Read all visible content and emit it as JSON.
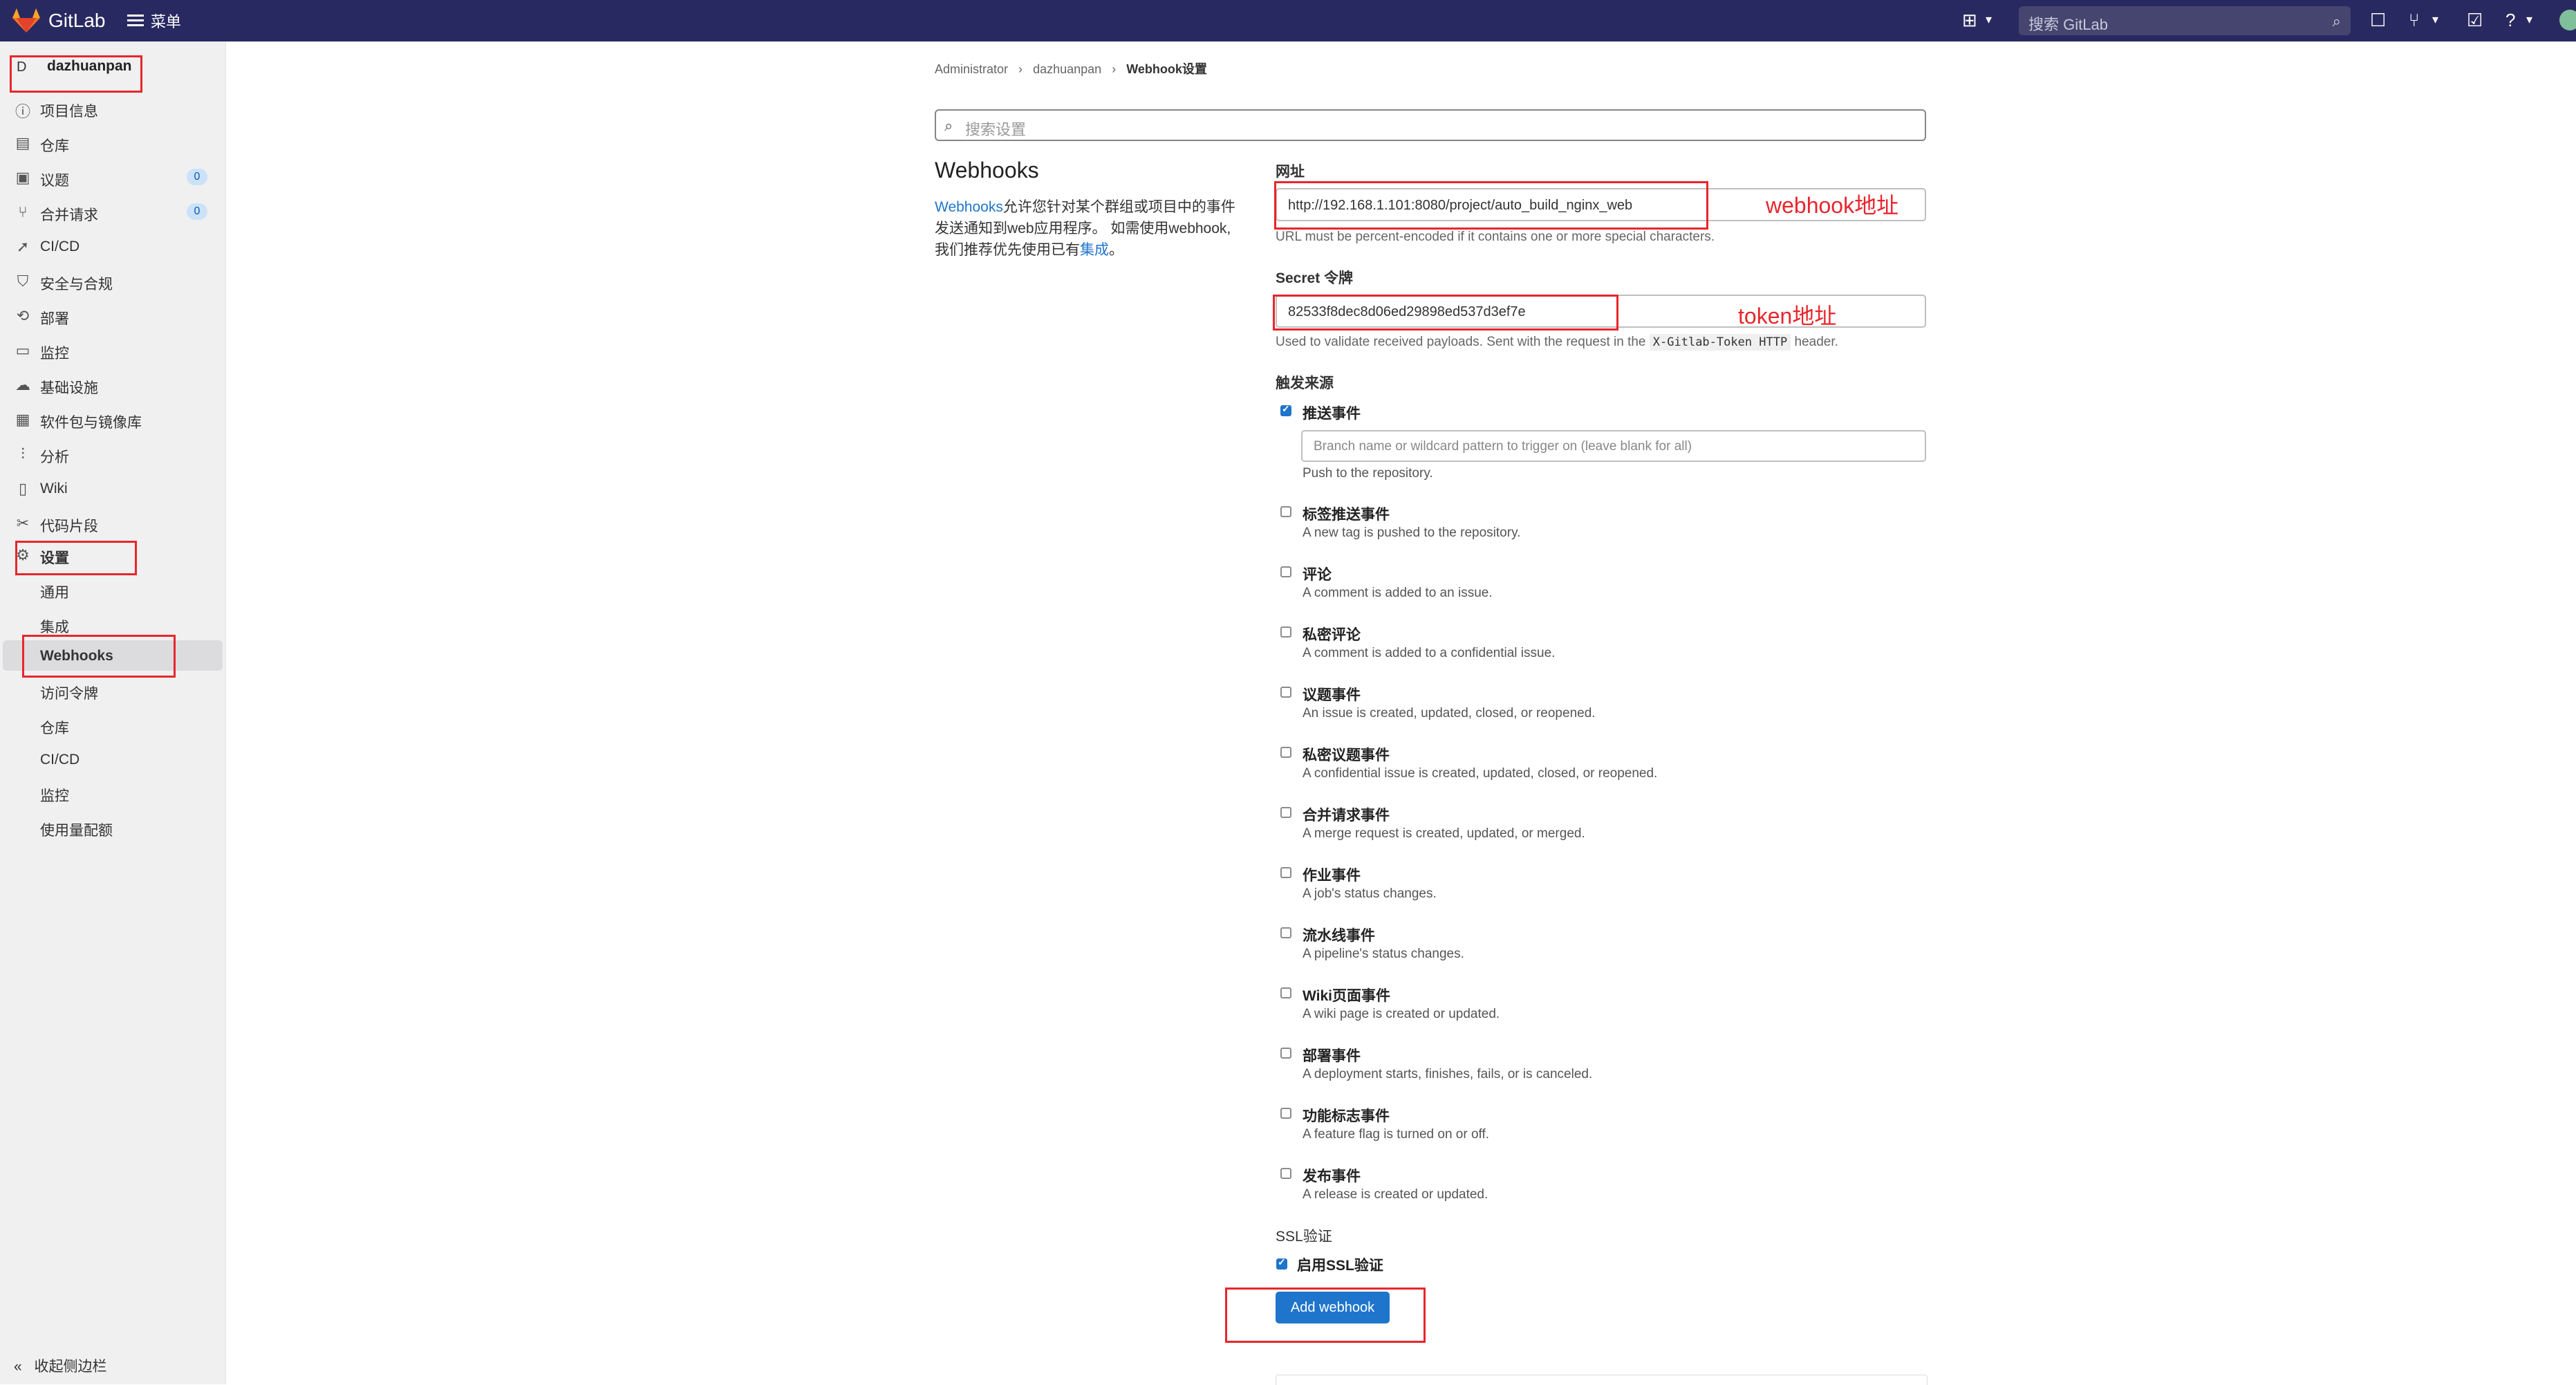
{
  "topnav": {
    "brand": "GitLab",
    "menu_label": "菜单",
    "search_placeholder": "搜索 GitLab",
    "icons": [
      "plus-square-icon",
      "chevron-down-icon",
      "issues-icon",
      "merge-request-icon",
      "todo-icon",
      "help-icon",
      "avatar"
    ]
  },
  "sidebar": {
    "project_avatar_letter": "D",
    "project_name": "dazhuanpan",
    "items": [
      {
        "label": "项目信息",
        "icon": "info-icon"
      },
      {
        "label": "仓库",
        "icon": "doc-icon"
      },
      {
        "label": "议题",
        "icon": "issues-icon",
        "count": "0"
      },
      {
        "label": "合并请求",
        "icon": "merge-request-icon",
        "count": "0"
      },
      {
        "label": "CI/CD",
        "icon": "rocket-icon"
      },
      {
        "label": "安全与合规",
        "icon": "shield-icon"
      },
      {
        "label": "部署",
        "icon": "deploy-icon"
      },
      {
        "label": "监控",
        "icon": "monitor-icon"
      },
      {
        "label": "基础设施",
        "icon": "cloud-icon"
      },
      {
        "label": "软件包与镜像库",
        "icon": "package-icon"
      },
      {
        "label": "分析",
        "icon": "chart-icon"
      },
      {
        "label": "Wiki",
        "icon": "book-icon"
      },
      {
        "label": "代码片段",
        "icon": "scissors-icon"
      },
      {
        "label": "设置",
        "icon": "gear-icon"
      }
    ],
    "settings_sub": [
      "通用",
      "集成",
      "Webhooks",
      "访问令牌",
      "仓库",
      "CI/CD",
      "监控",
      "使用量配额"
    ],
    "collapse_label": "收起侧边栏"
  },
  "breadcrumb": [
    "Administrator",
    "dazhuanpan",
    "Webhook设置"
  ],
  "settings_search_placeholder": "搜索设置",
  "section": {
    "title": "Webhooks",
    "desc_link": "Webhooks",
    "desc_text": "允许您针对某个群组或项目中的事件发送通知到web应用程序。 如需使用webhook,我们推荐优先使用已有",
    "desc_link2": "集成",
    "desc_end": "。"
  },
  "form": {
    "url_label": "网址",
    "url_value": "http://192.168.1.101:8080/project/auto_build_nginx_web",
    "url_help": "URL must be percent-encoded if it contains one or more special characters.",
    "secret_label": "Secret 令牌",
    "secret_value": "82533f8dec8d06ed29898ed537d3ef7e",
    "secret_help_pre": "Used to validate received payloads. Sent with the request in the",
    "secret_help_code": "X-Gitlab-Token HTTP",
    "secret_help_post": "header.",
    "trigger_label": "触发来源",
    "branch_placeholder": "Branch name or wildcard pattern to trigger on (leave blank for all)",
    "events": [
      {
        "title": "推送事件",
        "desc": "Push to the repository.",
        "checked": true
      },
      {
        "title": "标签推送事件",
        "desc": "A new tag is pushed to the repository.",
        "checked": false
      },
      {
        "title": "评论",
        "desc": "A comment is added to an issue.",
        "checked": false
      },
      {
        "title": "私密评论",
        "desc": "A comment is added to a confidential issue.",
        "checked": false
      },
      {
        "title": "议题事件",
        "desc": "An issue is created, updated, closed, or reopened.",
        "checked": false
      },
      {
        "title": "私密议题事件",
        "desc": "A confidential issue is created, updated, closed, or reopened.",
        "checked": false
      },
      {
        "title": "合并请求事件",
        "desc": "A merge request is created, updated, or merged.",
        "checked": false
      },
      {
        "title": "作业事件",
        "desc": "A job's status changes.",
        "checked": false
      },
      {
        "title": "流水线事件",
        "desc": "A pipeline's status changes.",
        "checked": false
      },
      {
        "title": "Wiki页面事件",
        "desc": "A wiki page is created or updated.",
        "checked": false
      },
      {
        "title": "部署事件",
        "desc": "A deployment starts, finishes, fails, or is canceled.",
        "checked": false
      },
      {
        "title": "功能标志事件",
        "desc": "A feature flag is turned on or off.",
        "checked": false
      },
      {
        "title": "发布事件",
        "desc": "A release is created or updated.",
        "checked": false
      }
    ],
    "ssl_label": "SSL验证",
    "ssl_checkbox_label": "启用SSL验证",
    "add_button": "Add webhook"
  },
  "annotations": {
    "webhook_note": "webhook地址",
    "token_note": "token地址"
  }
}
